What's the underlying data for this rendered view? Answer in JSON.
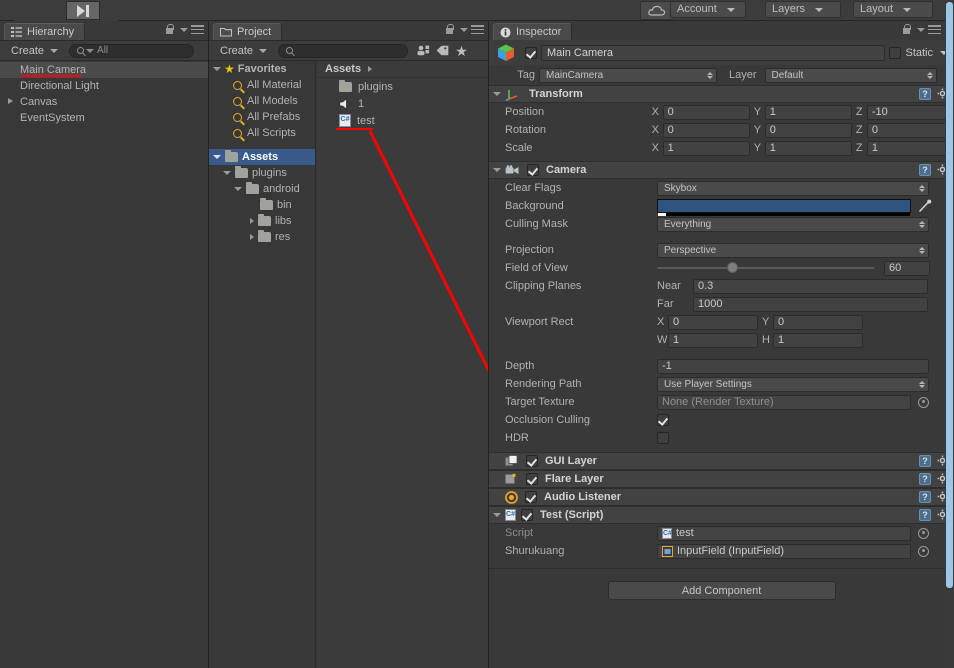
{
  "app": {
    "title": "Unity Editor"
  },
  "toolbar": {
    "account_label": "Account",
    "layers_label": "Layers",
    "layout_label": "Layout",
    "cloud_icon": "cloud-icon",
    "play_icon": "play-icon",
    "pause_icon": "pause-icon",
    "step_icon": "step-icon"
  },
  "hierarchy": {
    "tab_label": "Hierarchy",
    "create_label": "Create",
    "search_placeholder": "All",
    "items": [
      {
        "label": "Main Camera",
        "selected": true,
        "expandable": false,
        "underlined": true
      },
      {
        "label": "Directional Light",
        "selected": false,
        "expandable": false,
        "underlined": false
      },
      {
        "label": "Canvas",
        "selected": false,
        "expandable": true,
        "underlined": false
      },
      {
        "label": "EventSystem",
        "selected": false,
        "expandable": false,
        "underlined": false
      }
    ]
  },
  "project": {
    "tab_label": "Project",
    "create_label": "Create",
    "search_placeholder": "",
    "favorites_label": "Favorites",
    "favorites": [
      {
        "label": "All Material"
      },
      {
        "label": "All Models"
      },
      {
        "label": "All Prefabs"
      },
      {
        "label": "All Scripts"
      }
    ],
    "tree": [
      {
        "label": "Assets",
        "depth": 0,
        "selected": true,
        "expanded": true,
        "bold": true
      },
      {
        "label": "plugins",
        "depth": 1,
        "selected": false,
        "expanded": true,
        "bold": false
      },
      {
        "label": "android",
        "depth": 2,
        "selected": false,
        "expanded": true,
        "bold": false
      },
      {
        "label": "bin",
        "depth": 3,
        "selected": false,
        "expanded": null,
        "bold": false
      },
      {
        "label": "libs",
        "depth": 3,
        "selected": false,
        "expanded": false,
        "bold": false
      },
      {
        "label": "res",
        "depth": 3,
        "selected": false,
        "expanded": false,
        "bold": false
      }
    ],
    "breadcrumb": "Assets",
    "assets": [
      {
        "label": "plugins",
        "icon": "folder-icon"
      },
      {
        "label": "1",
        "icon": "audio-clip-icon"
      },
      {
        "label": "test",
        "icon": "csharp-script-icon"
      }
    ]
  },
  "inspector": {
    "tab_label": "Inspector",
    "object_name": "Main Camera",
    "object_enabled": true,
    "static_label": "Static",
    "static_checked": false,
    "tag_label": "Tag",
    "tag_value": "MainCamera",
    "layer_label": "Layer",
    "layer_value": "Default",
    "transform": {
      "title": "Transform",
      "rows": [
        {
          "label": "Position",
          "x": "0",
          "y": "1",
          "z": "-10"
        },
        {
          "label": "Rotation",
          "x": "0",
          "y": "0",
          "z": "0"
        },
        {
          "label": "Scale",
          "x": "1",
          "y": "1",
          "z": "1"
        }
      ]
    },
    "camera": {
      "title": "Camera",
      "enabled": true,
      "clear_flags_label": "Clear Flags",
      "clear_flags_value": "Skybox",
      "background_label": "Background",
      "background_color": "#31537f",
      "culling_mask_label": "Culling Mask",
      "culling_mask_value": "Everything",
      "projection_label": "Projection",
      "projection_value": "Perspective",
      "fov_label": "Field of View",
      "fov_value": "60",
      "clipping_label": "Clipping Planes",
      "near_label": "Near",
      "near_value": "0.3",
      "far_label": "Far",
      "far_value": "1000",
      "viewport_label": "Viewport Rect",
      "viewport_x": "0",
      "viewport_y": "0",
      "viewport_w": "1",
      "viewport_h": "1",
      "depth_label": "Depth",
      "depth_value": "-1",
      "rendering_path_label": "Rendering Path",
      "rendering_path_value": "Use Player Settings",
      "target_texture_label": "Target Texture",
      "target_texture_value": "None (Render Texture)",
      "occlusion_label": "Occlusion Culling",
      "occlusion_checked": true,
      "hdr_label": "HDR",
      "hdr_checked": false
    },
    "components": [
      {
        "title": "GUI Layer",
        "enabled": true,
        "icon": "gui-layer-icon"
      },
      {
        "title": "Flare Layer",
        "enabled": true,
        "icon": "flare-layer-icon"
      },
      {
        "title": "Audio Listener",
        "enabled": true,
        "icon": "audio-listener-icon"
      }
    ],
    "script_component": {
      "title": "Test (Script)",
      "enabled": true,
      "script_label": "Script",
      "script_value": "test",
      "field_label": "Shurukuang",
      "field_value": "InputField (InputField)"
    },
    "add_component_label": "Add Component"
  },
  "annotation": {
    "underline_color": "#ff0000",
    "arrow_color": "#ff0000"
  }
}
